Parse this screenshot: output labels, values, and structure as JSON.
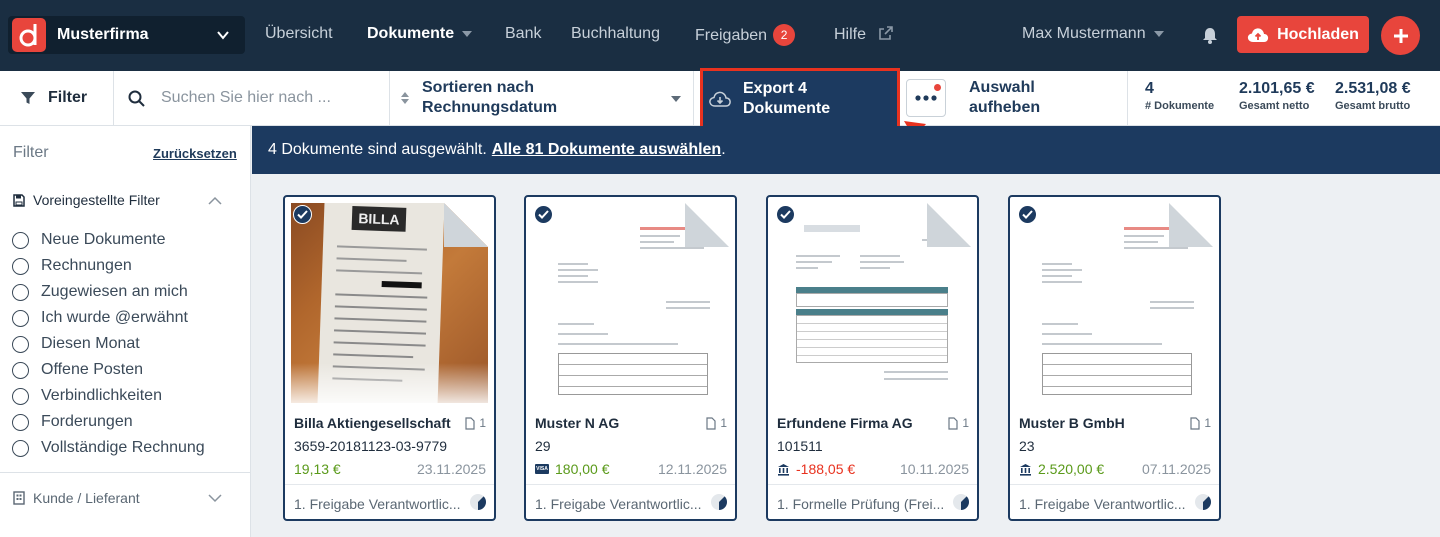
{
  "brand": {
    "company": "Musterfirma",
    "accent": "#e8453c",
    "navy": "#1c3a60"
  },
  "nav": {
    "items": [
      {
        "label": "Übersicht"
      },
      {
        "label": "Dokumente"
      },
      {
        "label": "Bank"
      },
      {
        "label": "Buchhaltung"
      },
      {
        "label": "Freigaben",
        "badge": "2"
      },
      {
        "label": "Hilfe"
      }
    ],
    "user": "Max Mustermann",
    "upload": "Hochladen"
  },
  "toolbar": {
    "filter": "Filter",
    "search_placeholder": "Suchen Sie hier nach ...",
    "sort_line1": "Sortieren nach",
    "sort_line2": "Rechnungsdatum",
    "export_line1": "Export 4",
    "export_line2": "Dokumente",
    "deselect_line1": "Auswahl",
    "deselect_line2": "aufheben",
    "stats": [
      {
        "value": "4",
        "label": "# Dokumente"
      },
      {
        "value": "2.101,65 €",
        "label": "Gesamt netto"
      },
      {
        "value": "2.531,08 €",
        "label": "Gesamt brutto"
      }
    ]
  },
  "sidebar": {
    "title": "Filter",
    "reset": "Zurücksetzen",
    "preset_header": "Voreingestellte Filter",
    "presets": [
      "Neue Dokumente",
      "Rechnungen",
      "Zugewiesen an mich",
      "Ich wurde @erwähnt",
      "Diesen Monat",
      "Offene Posten",
      "Verbindlichkeiten",
      "Forderungen",
      "Vollständige Rechnung"
    ],
    "customer_header": "Kunde / Lieferant"
  },
  "banner": {
    "text": "4 Dokumente sind ausgewählt.",
    "link": "Alle 81 Dokumente auswählen",
    "suffix": "."
  },
  "cards": [
    {
      "title": "Billa Aktiengesellschaft",
      "pages": "1",
      "number": "3659-20181123-03-9779",
      "amount": "19,13 €",
      "amount_type": "positive",
      "pay_icon": "none",
      "date": "23.11.2025",
      "status": "1. Freigabe Verantwortlic..."
    },
    {
      "title": "Muster N AG",
      "pages": "1",
      "number": "29",
      "amount": "180,00 €",
      "amount_type": "positive",
      "pay_icon": "visa-card-icon",
      "date": "12.11.2025",
      "status": "1. Freigabe Verantwortlic..."
    },
    {
      "title": "Erfundene Firma AG",
      "pages": "1",
      "number": "101511",
      "amount": "-188,05 €",
      "amount_type": "negative",
      "pay_icon": "bank-icon",
      "date": "10.11.2025",
      "status": "1. Formelle Prüfung (Frei..."
    },
    {
      "title": "Muster B GmbH",
      "pages": "1",
      "number": "23",
      "amount": "2.520,00 €",
      "amount_type": "positive",
      "pay_icon": "bank-icon",
      "date": "07.11.2025",
      "status": "1. Freigabe Verantwortlic..."
    }
  ],
  "receipt_text": "BILLA"
}
